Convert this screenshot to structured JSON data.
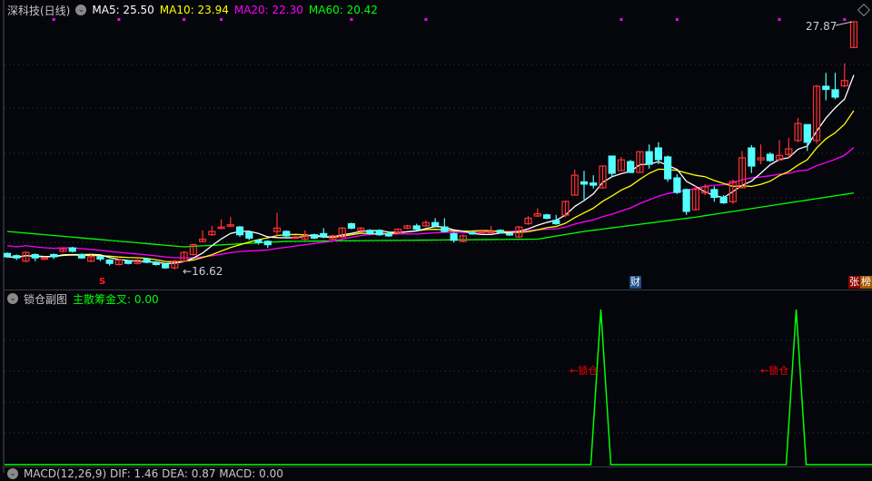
{
  "header": {
    "title": "深科技(日线)",
    "ma5_label": "MA5: 25.50",
    "ma10_label": "MA10: 23.94",
    "ma20_label": "MA20: 22.30",
    "ma60_label": "MA60: 20.42"
  },
  "colors": {
    "up": "#ff3232",
    "down": "#54ffff",
    "ma5": "#ffffff",
    "ma10": "#ffff00",
    "ma20": "#ff00ff",
    "ma60": "#00ff00",
    "signal": "#ff0000"
  },
  "price_labels": {
    "high": "27.87",
    "low": "16.62"
  },
  "markers": {
    "s_mark": "S",
    "finance_tag": "财",
    "rank_tag_1": "张",
    "rank_tag_2": "榜"
  },
  "sub_panel": {
    "title": "锁仓副图",
    "value_label": "主散筹金叉: 0.00",
    "signal_label_1": "←锁仓",
    "signal_label_2": "←锁仓"
  },
  "macd_panel": {
    "label": "MACD(12,26,9) DIF: 1.46 DEA: 0.87 MACD: 0.00"
  },
  "chart_data": {
    "type": "candlestick",
    "ohlc": [
      [
        17.35,
        17.2,
        17.4,
        17.15
      ],
      [
        17.25,
        17.15,
        17.3,
        17.05
      ],
      [
        17.0,
        17.4,
        17.45,
        16.95
      ],
      [
        17.3,
        17.15,
        17.35,
        17.0
      ],
      [
        17.1,
        17.15,
        17.2,
        17.05
      ],
      [
        17.3,
        17.2,
        17.35,
        17.1
      ],
      [
        17.45,
        17.55,
        17.6,
        17.4
      ],
      [
        17.6,
        17.45,
        17.65,
        17.4
      ],
      [
        17.3,
        17.15,
        17.35,
        17.1
      ],
      [
        17.0,
        17.2,
        17.3,
        16.95
      ],
      [
        17.2,
        17.1,
        17.25,
        17.0
      ],
      [
        17.05,
        16.9,
        17.1,
        16.8
      ],
      [
        16.85,
        17.05,
        17.1,
        16.8
      ],
      [
        17.0,
        16.9,
        17.05,
        16.85
      ],
      [
        16.9,
        17.05,
        17.1,
        16.85
      ],
      [
        17.1,
        16.95,
        17.15,
        16.9
      ],
      [
        16.95,
        16.85,
        17.0,
        16.8
      ],
      [
        16.85,
        16.7,
        16.9,
        16.65
      ],
      [
        16.7,
        17.0,
        17.05,
        16.62
      ],
      [
        17.0,
        17.4,
        17.45,
        16.95
      ],
      [
        17.3,
        17.75,
        17.8,
        17.25
      ],
      [
        17.9,
        18.0,
        18.4,
        17.85
      ],
      [
        18.2,
        18.35,
        18.6,
        18.15
      ],
      [
        18.5,
        18.55,
        18.9,
        18.45
      ],
      [
        18.6,
        18.65,
        19.0,
        18.55
      ],
      [
        18.55,
        18.2,
        18.6,
        18.1
      ],
      [
        18.3,
        18.05,
        18.35,
        17.95
      ],
      [
        17.95,
        17.85,
        18.0,
        17.75
      ],
      [
        17.9,
        17.75,
        17.95,
        17.6
      ],
      [
        18.35,
        18.5,
        19.2,
        18.1
      ],
      [
        18.35,
        18.15,
        18.4,
        18.05
      ],
      [
        18.05,
        18.1,
        18.15,
        18.05
      ],
      [
        18.0,
        18.15,
        18.4,
        17.95
      ],
      [
        18.2,
        18.05,
        18.25,
        18.0
      ],
      [
        18.25,
        18.1,
        18.5,
        18.05
      ],
      [
        18.0,
        18.15,
        18.2,
        17.95
      ],
      [
        18.1,
        18.5,
        18.55,
        18.05
      ],
      [
        18.7,
        18.5,
        18.75,
        18.45
      ],
      [
        18.4,
        18.5,
        18.55,
        18.35
      ],
      [
        18.4,
        18.25,
        18.45,
        18.2
      ],
      [
        18.4,
        18.2,
        18.45,
        18.15
      ],
      [
        18.25,
        18.15,
        18.3,
        18.1
      ],
      [
        18.3,
        18.45,
        18.5,
        18.25
      ],
      [
        18.5,
        18.6,
        18.65,
        18.45
      ],
      [
        18.6,
        18.45,
        18.7,
        18.4
      ],
      [
        18.6,
        18.75,
        18.85,
        18.55
      ],
      [
        18.75,
        18.6,
        18.95,
        18.55
      ],
      [
        18.55,
        18.35,
        18.95,
        18.3
      ],
      [
        18.25,
        17.95,
        18.3,
        17.85
      ],
      [
        17.9,
        18.15,
        18.2,
        17.85
      ],
      [
        18.3,
        18.25,
        18.35,
        18.2
      ],
      [
        18.3,
        18.35,
        18.4,
        18.25
      ],
      [
        18.3,
        18.35,
        18.6,
        18.25
      ],
      [
        18.4,
        18.3,
        18.45,
        18.25
      ],
      [
        18.25,
        18.2,
        18.3,
        18.15
      ],
      [
        18.1,
        18.55,
        18.6,
        18.05
      ],
      [
        18.7,
        18.95,
        19.05,
        18.65
      ],
      [
        19.05,
        19.15,
        19.4,
        19.0
      ],
      [
        19.1,
        18.95,
        19.15,
        18.9
      ],
      [
        18.85,
        18.7,
        19.1,
        18.65
      ],
      [
        19.09,
        19.71,
        19.75,
        19.0
      ],
      [
        20.0,
        20.9,
        21.15,
        19.98
      ],
      [
        20.6,
        20.5,
        21.1,
        19.8
      ],
      [
        20.55,
        20.45,
        20.9,
        20.3
      ],
      [
        20.33,
        21.32,
        21.32,
        20.3
      ],
      [
        21.77,
        20.99,
        21.77,
        20.8
      ],
      [
        21.11,
        21.6,
        21.73,
        21.1
      ],
      [
        21.52,
        21.03,
        21.6,
        21.0
      ],
      [
        21.03,
        21.97,
        22.0,
        21.0
      ],
      [
        21.97,
        21.4,
        22.3,
        21.2
      ],
      [
        22.14,
        21.61,
        22.4,
        21.4
      ],
      [
        21.73,
        20.74,
        21.8,
        20.6
      ],
      [
        20.78,
        20.12,
        20.95,
        20.05
      ],
      [
        20.25,
        19.26,
        20.3,
        19.1
      ],
      [
        19.34,
        20.25,
        20.4,
        19.3
      ],
      [
        20.1,
        20.37,
        20.5,
        20.0
      ],
      [
        20.25,
        19.9,
        20.4,
        19.7
      ],
      [
        19.9,
        19.65,
        20.0,
        19.6
      ],
      [
        19.7,
        20.62,
        20.7,
        19.6
      ],
      [
        20.33,
        21.69,
        22.0,
        20.3
      ],
      [
        22.14,
        21.32,
        22.27,
        21.0
      ],
      [
        21.6,
        21.69,
        22.3,
        21.4
      ],
      [
        21.85,
        21.57,
        21.95,
        21.5
      ],
      [
        21.6,
        21.8,
        22.5,
        21.55
      ],
      [
        21.85,
        22.1,
        22.6,
        21.7
      ],
      [
        22.48,
        23.25,
        23.5,
        22.4
      ],
      [
        23.2,
        22.4,
        23.2,
        22.0
      ],
      [
        22.48,
        24.94,
        25.0,
        22.35
      ],
      [
        24.94,
        24.8,
        25.55,
        24.3
      ],
      [
        24.78,
        24.45,
        25.55,
        24.35
      ],
      [
        24.96,
        25.2,
        25.98,
        24.9
      ],
      [
        26.7,
        27.87,
        27.87,
        26.7
      ]
    ],
    "ma60_keypoints": [
      [
        0,
        18.35
      ],
      [
        19,
        17.65
      ],
      [
        30,
        17.9
      ],
      [
        57,
        18.0
      ],
      [
        62,
        18.35
      ],
      [
        74,
        19.0
      ],
      [
        96,
        20.42
      ]
    ],
    "signal_dots_index": [
      5,
      12,
      19,
      23,
      37,
      45,
      66,
      72,
      83,
      90,
      95
    ],
    "sub_indicator": {
      "spikes_index": [
        64,
        85
      ],
      "value": 0.0
    }
  }
}
